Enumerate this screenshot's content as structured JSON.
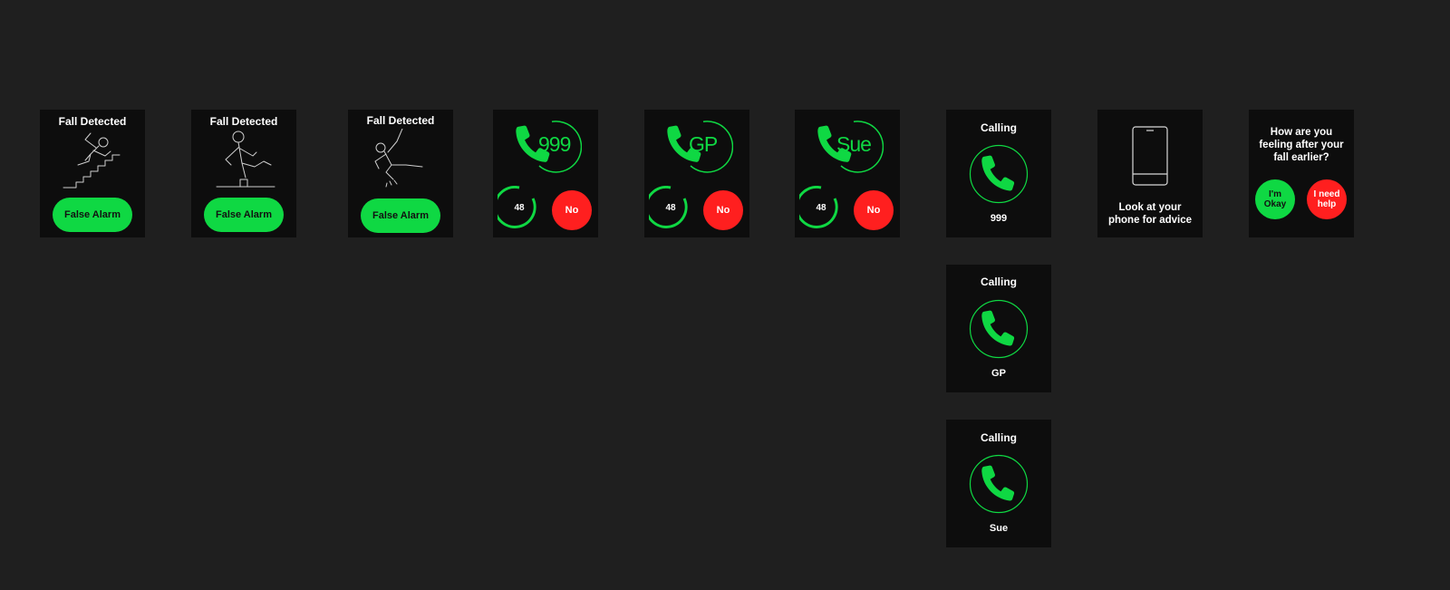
{
  "colors": {
    "background": "#1f1f1f",
    "screen": "#0d0d0d",
    "accent_green": "#0fd843",
    "danger_red": "#ff1f1f",
    "text": "#ffffff"
  },
  "fall_screens": [
    {
      "title": "Fall Detected",
      "button": "False Alarm",
      "icon": "stairs-fall-icon"
    },
    {
      "title": "Fall Detected",
      "button": "False Alarm",
      "icon": "trip-fall-icon"
    },
    {
      "title": "Fall Detected",
      "button": "False Alarm",
      "icon": "slip-fall-icon"
    }
  ],
  "countdown_screens": [
    {
      "contact": "999",
      "countdown": "48",
      "cancel": "No",
      "icon": "phone-icon"
    },
    {
      "contact": "GP",
      "countdown": "48",
      "cancel": "No",
      "icon": "phone-icon"
    },
    {
      "contact": "Sue",
      "countdown": "48",
      "cancel": "No",
      "icon": "phone-icon"
    }
  ],
  "calling_screens": [
    {
      "status": "Calling",
      "contact": "999",
      "icon": "phone-icon"
    },
    {
      "status": "Calling",
      "contact": "GP",
      "icon": "phone-icon"
    },
    {
      "status": "Calling",
      "contact": "Sue",
      "icon": "phone-icon"
    }
  ],
  "phone_screen": {
    "message_line1": "Look at your",
    "message_line2": "phone for advice",
    "icon": "smartphone-icon"
  },
  "feeling_screen": {
    "question_line1": "How are you",
    "question_line2": "feeling after your",
    "question_line3": "fall earlier?",
    "okay_line1": "I'm",
    "okay_line2": "Okay",
    "help_line1": "I need",
    "help_line2": "help"
  }
}
